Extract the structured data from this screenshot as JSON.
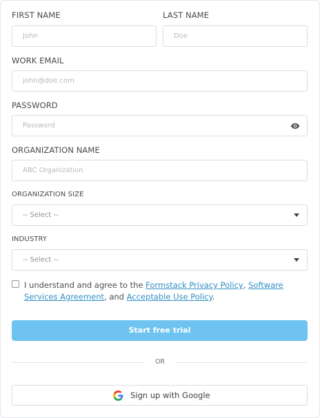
{
  "form": {
    "first_name": {
      "label": "FIRST NAME",
      "placeholder": "John"
    },
    "last_name": {
      "label": "LAST NAME",
      "placeholder": "Doe"
    },
    "work_email": {
      "label": "WORK EMAIL",
      "placeholder": "john@doe.com"
    },
    "password": {
      "label": "PASSWORD",
      "placeholder": "Password",
      "toggle_icon": "eye-icon"
    },
    "organization_name": {
      "label": "ORGANIZATION NAME",
      "placeholder": "ABC Organization"
    },
    "organization_size": {
      "label": "ORGANIZATION SIZE",
      "selected": "-- Select --"
    },
    "industry": {
      "label": "INDUSTRY",
      "selected": "-- Select --"
    },
    "consent": {
      "prefix": "I understand and agree to the ",
      "privacy_link": "Formstack Privacy Policy",
      "sep1": ", ",
      "software_link": "Software Services Agreement",
      "sep2": ", and ",
      "aup_link": "Acceptable Use Policy",
      "suffix": "."
    },
    "submit_label": "Start free trial",
    "divider_label": "OR",
    "google_label": "Sign up with Google"
  },
  "colors": {
    "accent": "#6ec3f0",
    "link": "#2f8fc4",
    "border": "#d9dde2"
  }
}
